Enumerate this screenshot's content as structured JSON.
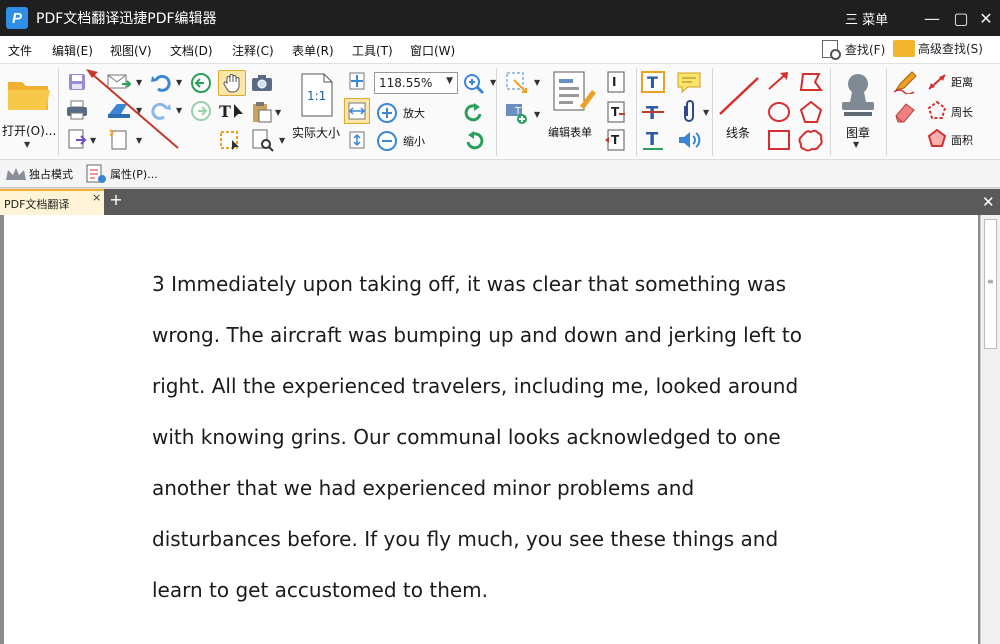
{
  "window": {
    "title": "PDF文档翻译迅捷PDF编辑器",
    "logo_letter": "P",
    "menu_label": "三 菜单",
    "min_symbol": "—",
    "max_symbol": "▢",
    "close_symbol": "✕"
  },
  "menubar": {
    "items": [
      "文件",
      "编辑(E)",
      "视图(V)",
      "文档(D)",
      "注释(C)",
      "表单(R)",
      "工具(T)",
      "窗口(W)"
    ],
    "find": "查找(F)",
    "advanced_find": "高级查找(S)"
  },
  "ribbon": {
    "open": "打开(O)...",
    "actual_size": "实际大小",
    "actual_size_icon_text": "1:1",
    "zoom_value": "118.55%",
    "zoom_in": "放大",
    "zoom_out": "缩小",
    "edit_form": "编辑表单",
    "line": "线条",
    "stamp": "图章",
    "distance": "距离",
    "perimeter": "周长",
    "area": "面积"
  },
  "toolbar2": {
    "exclusive_mode": "独占模式",
    "properties": "属性(P)..."
  },
  "tabs": {
    "active": "PDF文档翻译",
    "close": "×",
    "add": "+",
    "close_all": "✕"
  },
  "document": {
    "lines": [
      "3 Immediately upon taking off, it was clear that something was",
      "wrong. The aircraft was bumping up and down and jerking left to",
      "right. All the experienced travelers, including me, looked around",
      "with knowing grins. Our communal looks acknowledged to one",
      "another that we had experienced minor problems and",
      "disturbances before. If you fly much, you see these things and",
      "learn to get accustomed to them."
    ]
  },
  "colors": {
    "accent_orange": "#f0b030",
    "title_bar": "#1f1f1f",
    "annotation_arrow": "#c0392b",
    "tool_blue": "#2e8ee8"
  }
}
